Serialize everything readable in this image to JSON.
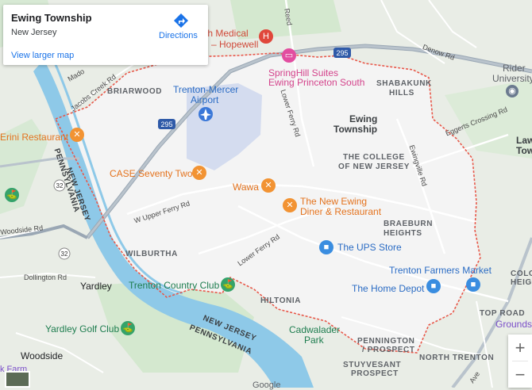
{
  "info_card": {
    "title": "Ewing Township",
    "subtitle": "New Jersey",
    "larger_map_link": "View larger map",
    "directions_label": "Directions"
  },
  "labels": {
    "briarwood": "BRIARWOOD",
    "airport_line1": "Trenton-Mercer",
    "airport_line2": "Airport",
    "ewing_line1": "Ewing",
    "ewing_line2": "Township",
    "college_line1": "THE COLLEGE",
    "college_line2": "OF NEW JERSEY",
    "shabakunk_line1": "SHABAKUNK",
    "shabakunk_line2": "HILLS",
    "braeburn_line1": "BRAEBURN",
    "braeburn_line2": "HEIGHTS",
    "wilburtha": "WILBURTHA",
    "hiltonia": "HILTONIA",
    "pennington_line1": "PENNINGTON",
    "pennington_line2": "/ PROSPECT",
    "stuyvesant_line1": "STUYVESANT",
    "stuyvesant_line2": "PROSPECT",
    "north_trenton": "NORTH TRENTON",
    "top_road": "TOP ROAD",
    "yardley": "Yardley",
    "woodside": "Woodside",
    "nj_river_line1": "NEW JERSEY",
    "nj_river_line2": "PENNSYLVANIA",
    "nj_bottom_line1": "NEW JERSEY",
    "nj_bottom_line2": "PENNSYLVANIA",
    "cadwalader_line1": "Cadwalader",
    "cadwalader_line2": "Park",
    "rider_line1": "Rider",
    "rider_line2": "University",
    "law_line1": "Law",
    "law_line2": "Tow",
    "colo_line1": "COLO",
    "colo_line2": "HEIG",
    "grounds": "Grounds",
    "farm": "k Farm",
    "google": "Google"
  },
  "roads": {
    "reed": "Reed",
    "denow": "Denow Rd",
    "jacobs_creek": "Jacobs Creek Rd",
    "mado": "Mado",
    "lower_ferry_n": "Lower Ferry Rd",
    "eggerts": "Eggerts Crossing Rd",
    "ewingville": "Ewingville Rd",
    "upper_ferry": "W Upper Ferry Rd",
    "woodside_rd": "Woodside Rd",
    "dollington": "Dollington Rd",
    "lower_ferry_s": "Lower Ferry Rd",
    "hwy_295_top": "295",
    "hwy_295": "295",
    "hwy_32_a": "32",
    "hwy_32_b": "32",
    "ave": "Ave"
  },
  "pois": {
    "health_line1": "th Medical",
    "health_line2": "– Hopewell",
    "springhill_line1": "SpringHill Suites",
    "springhill_line2": "Ewing Princeton South",
    "erini": "Erini Restaurant",
    "case": "CASE Seventy Two",
    "wawa": "Wawa",
    "new_ewing_line1": "The New Ewing",
    "new_ewing_line2": "Diner & Restaurant",
    "ups": "The UPS Store",
    "farmers": "Trenton Farmers Market",
    "home_depot": "The Home Depot",
    "country_club": "Trenton Country Club",
    "golf_club": "Yardley Golf Club"
  },
  "zoom": {
    "in": "+",
    "out": "−"
  },
  "colors": {
    "land": "#e9ede6",
    "township": "#f4f4f4",
    "water": "#8ec9e8",
    "park": "#c8e6c9",
    "boundary": "#e8584a",
    "road": "#ffffff",
    "highway": "#9aa7b4",
    "airport": "#d4dcef",
    "food": "#f29333",
    "shop": "#3a8de0",
    "park_pin": "#34a36a",
    "hotel": "#e24da0",
    "hospital": "#e0473b"
  }
}
